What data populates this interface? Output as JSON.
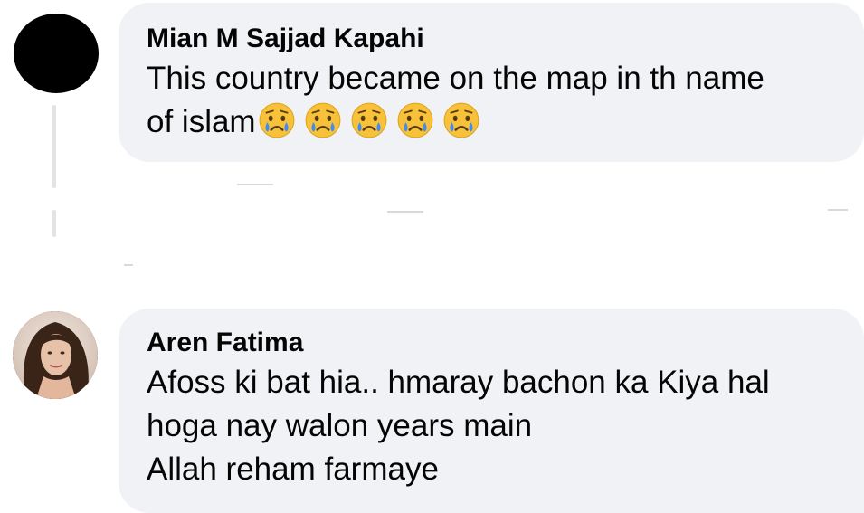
{
  "comments": [
    {
      "author": "Mian M Sajjad Kapahi",
      "lines": [
        "This country became on the map in th name",
        "of islam"
      ],
      "emojis": [
        "crying-face",
        "crying-face",
        "crying-face",
        "crying-face",
        "crying-face"
      ]
    },
    {
      "author": "Aren Fatima",
      "lines": [
        "Afoss ki bat hia.. hmaray bachon ka Kiya hal",
        "hoga nay walon years main",
        "Allah reham farmaye"
      ]
    }
  ],
  "colors": {
    "bubble": "#f0f2f5",
    "text": "#050505",
    "thread_line": "#e3e3e6",
    "emoji_face": "#f7c23a",
    "emoji_tear": "#3f8df1"
  }
}
